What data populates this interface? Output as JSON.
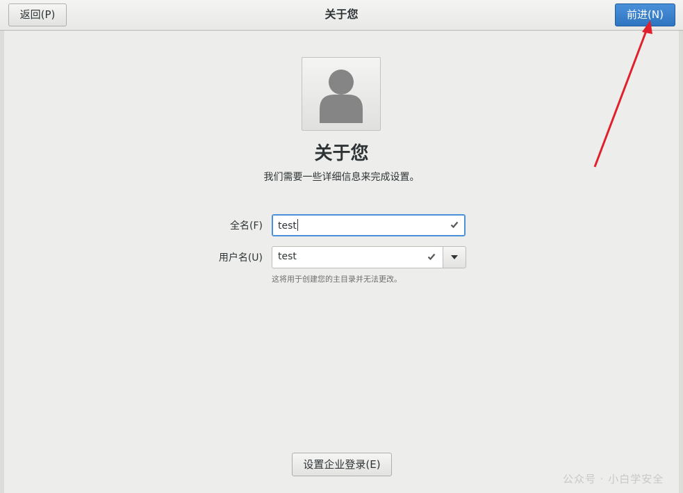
{
  "header": {
    "back_label": "返回(P)",
    "title": "关于您",
    "next_label": "前进(N)"
  },
  "main": {
    "title": "关于您",
    "subtitle": "我们需要一些详细信息来完成设置。"
  },
  "form": {
    "fullname": {
      "label": "全名(F)",
      "value": "test"
    },
    "username": {
      "label": "用户名(U)",
      "value": "test",
      "hint": "这将用于创建您的主目录并无法更改。"
    }
  },
  "footer": {
    "enterprise_login_label": "设置企业登录(E)"
  },
  "watermark": "公众号 · 小白学安全",
  "colors": {
    "accent": "#3584d6",
    "annotation_arrow": "#e0202a"
  },
  "icons": {
    "avatar": "user-avatar-icon",
    "check": "check-icon",
    "dropdown": "chevron-down-icon"
  }
}
